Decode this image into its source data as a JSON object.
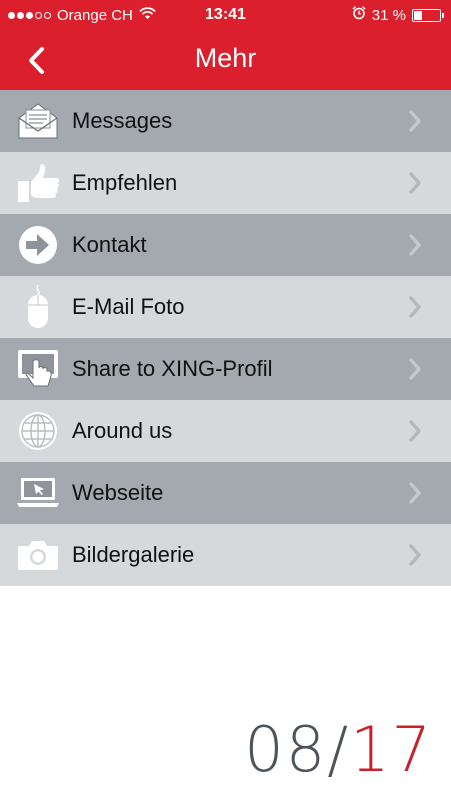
{
  "status_bar": {
    "carrier": "Orange CH",
    "time": "13:41",
    "battery": "31 %",
    "battery_level": 0.31
  },
  "navbar": {
    "title": "Mehr"
  },
  "menu": {
    "items": [
      {
        "label": "Messages",
        "icon": "envelope-icon"
      },
      {
        "label": "Empfehlen",
        "icon": "thumbs-up-icon"
      },
      {
        "label": "Kontakt",
        "icon": "arrow-circle-icon"
      },
      {
        "label": "E-Mail Foto",
        "icon": "mouse-icon"
      },
      {
        "label": "Share to XING-Profil",
        "icon": "touch-screen-icon"
      },
      {
        "label": "Around us",
        "icon": "globe-icon"
      },
      {
        "label": "Webseite",
        "icon": "laptop-icon"
      },
      {
        "label": "Bildergalerie",
        "icon": "camera-icon"
      }
    ]
  },
  "page_indicator": {
    "current": "08",
    "separator": "/",
    "total": "17"
  },
  "colors": {
    "header": "#dc1f2c",
    "row_dark": "#a3a9ae",
    "row_light": "#d5d9dc",
    "accent": "#c8222a"
  }
}
